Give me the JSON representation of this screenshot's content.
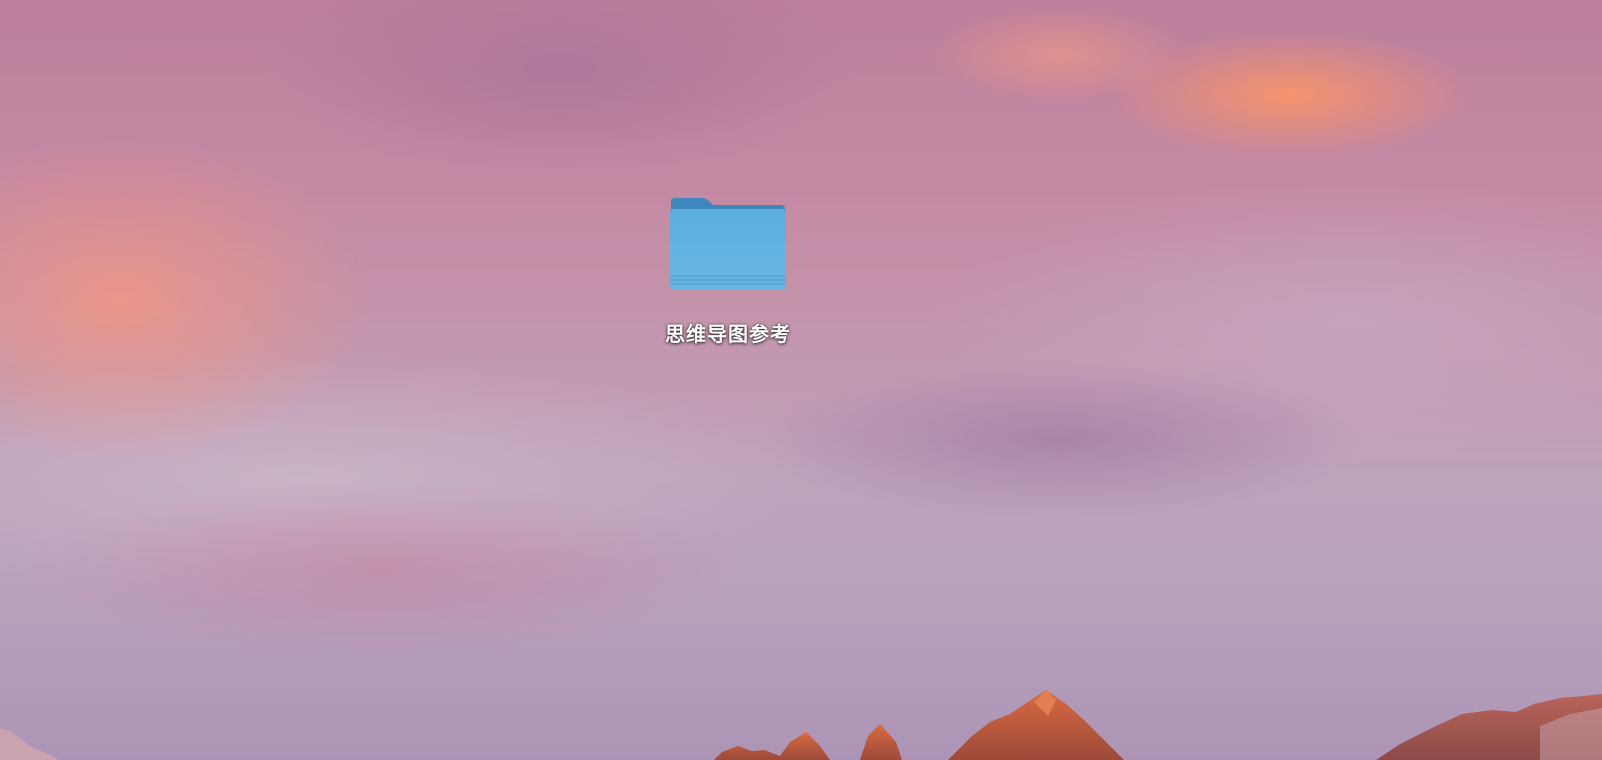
{
  "desktop": {
    "icons": [
      {
        "label": "思维导图参考",
        "icon": "folder-icon",
        "color": "#5aaee0"
      }
    ]
  }
}
